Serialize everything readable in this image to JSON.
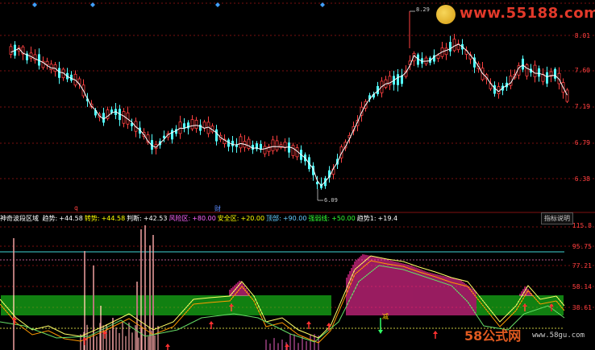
{
  "price_axis": [
    "8.01",
    "7.60",
    "7.19",
    "6.79",
    "6.38"
  ],
  "indicator_axis": [
    "115.8",
    "95.75",
    "77.21",
    "58.14",
    "38.61"
  ],
  "annotations": {
    "high": "8.29",
    "low": "6.09",
    "mark_q": "q",
    "mark_fin": "财",
    "mark_jian": "减"
  },
  "formula": {
    "name": "神奇波段区域",
    "items": [
      {
        "label": "趋势:",
        "value": "+44.58",
        "label_color": "#ffffff",
        "value_color": "#ffffff"
      },
      {
        "label": "转势:",
        "value": "+44.58",
        "label_color": "#ffff00",
        "value_color": "#ffff00"
      },
      {
        "label": "判断:",
        "value": "+42.53",
        "label_color": "#ffffff",
        "value_color": "#ffffff"
      },
      {
        "label": "风险区:",
        "value": "+80.00",
        "label_color": "#ff66ff",
        "value_color": "#ff66ff"
      },
      {
        "label": "安全区:",
        "value": "+20.00",
        "label_color": "#ffff00",
        "value_color": "#ffff00"
      },
      {
        "label": "顶部:",
        "value": "+90.00",
        "label_color": "#66ccff",
        "value_color": "#66ccff"
      },
      {
        "label": "强弱线:",
        "value": "+50.00",
        "label_color": "#33ff33",
        "value_color": "#33ff33"
      },
      {
        "label": "趋势1:",
        "value": "+19.4",
        "label_color": "#ffffff",
        "value_color": "#ffffff"
      }
    ]
  },
  "help_button": "指标说明",
  "watermark": {
    "top": "www.55188.com",
    "bottom_brand": "58公式网",
    "bottom_url": "www.58gu.com"
  },
  "colors": {
    "up": "#ff4040",
    "down": "#54ffff",
    "ma": "#ffffff",
    "risk": "#ff2fa0",
    "safe": "#22ff22",
    "top_line": "#33aaaa"
  }
}
